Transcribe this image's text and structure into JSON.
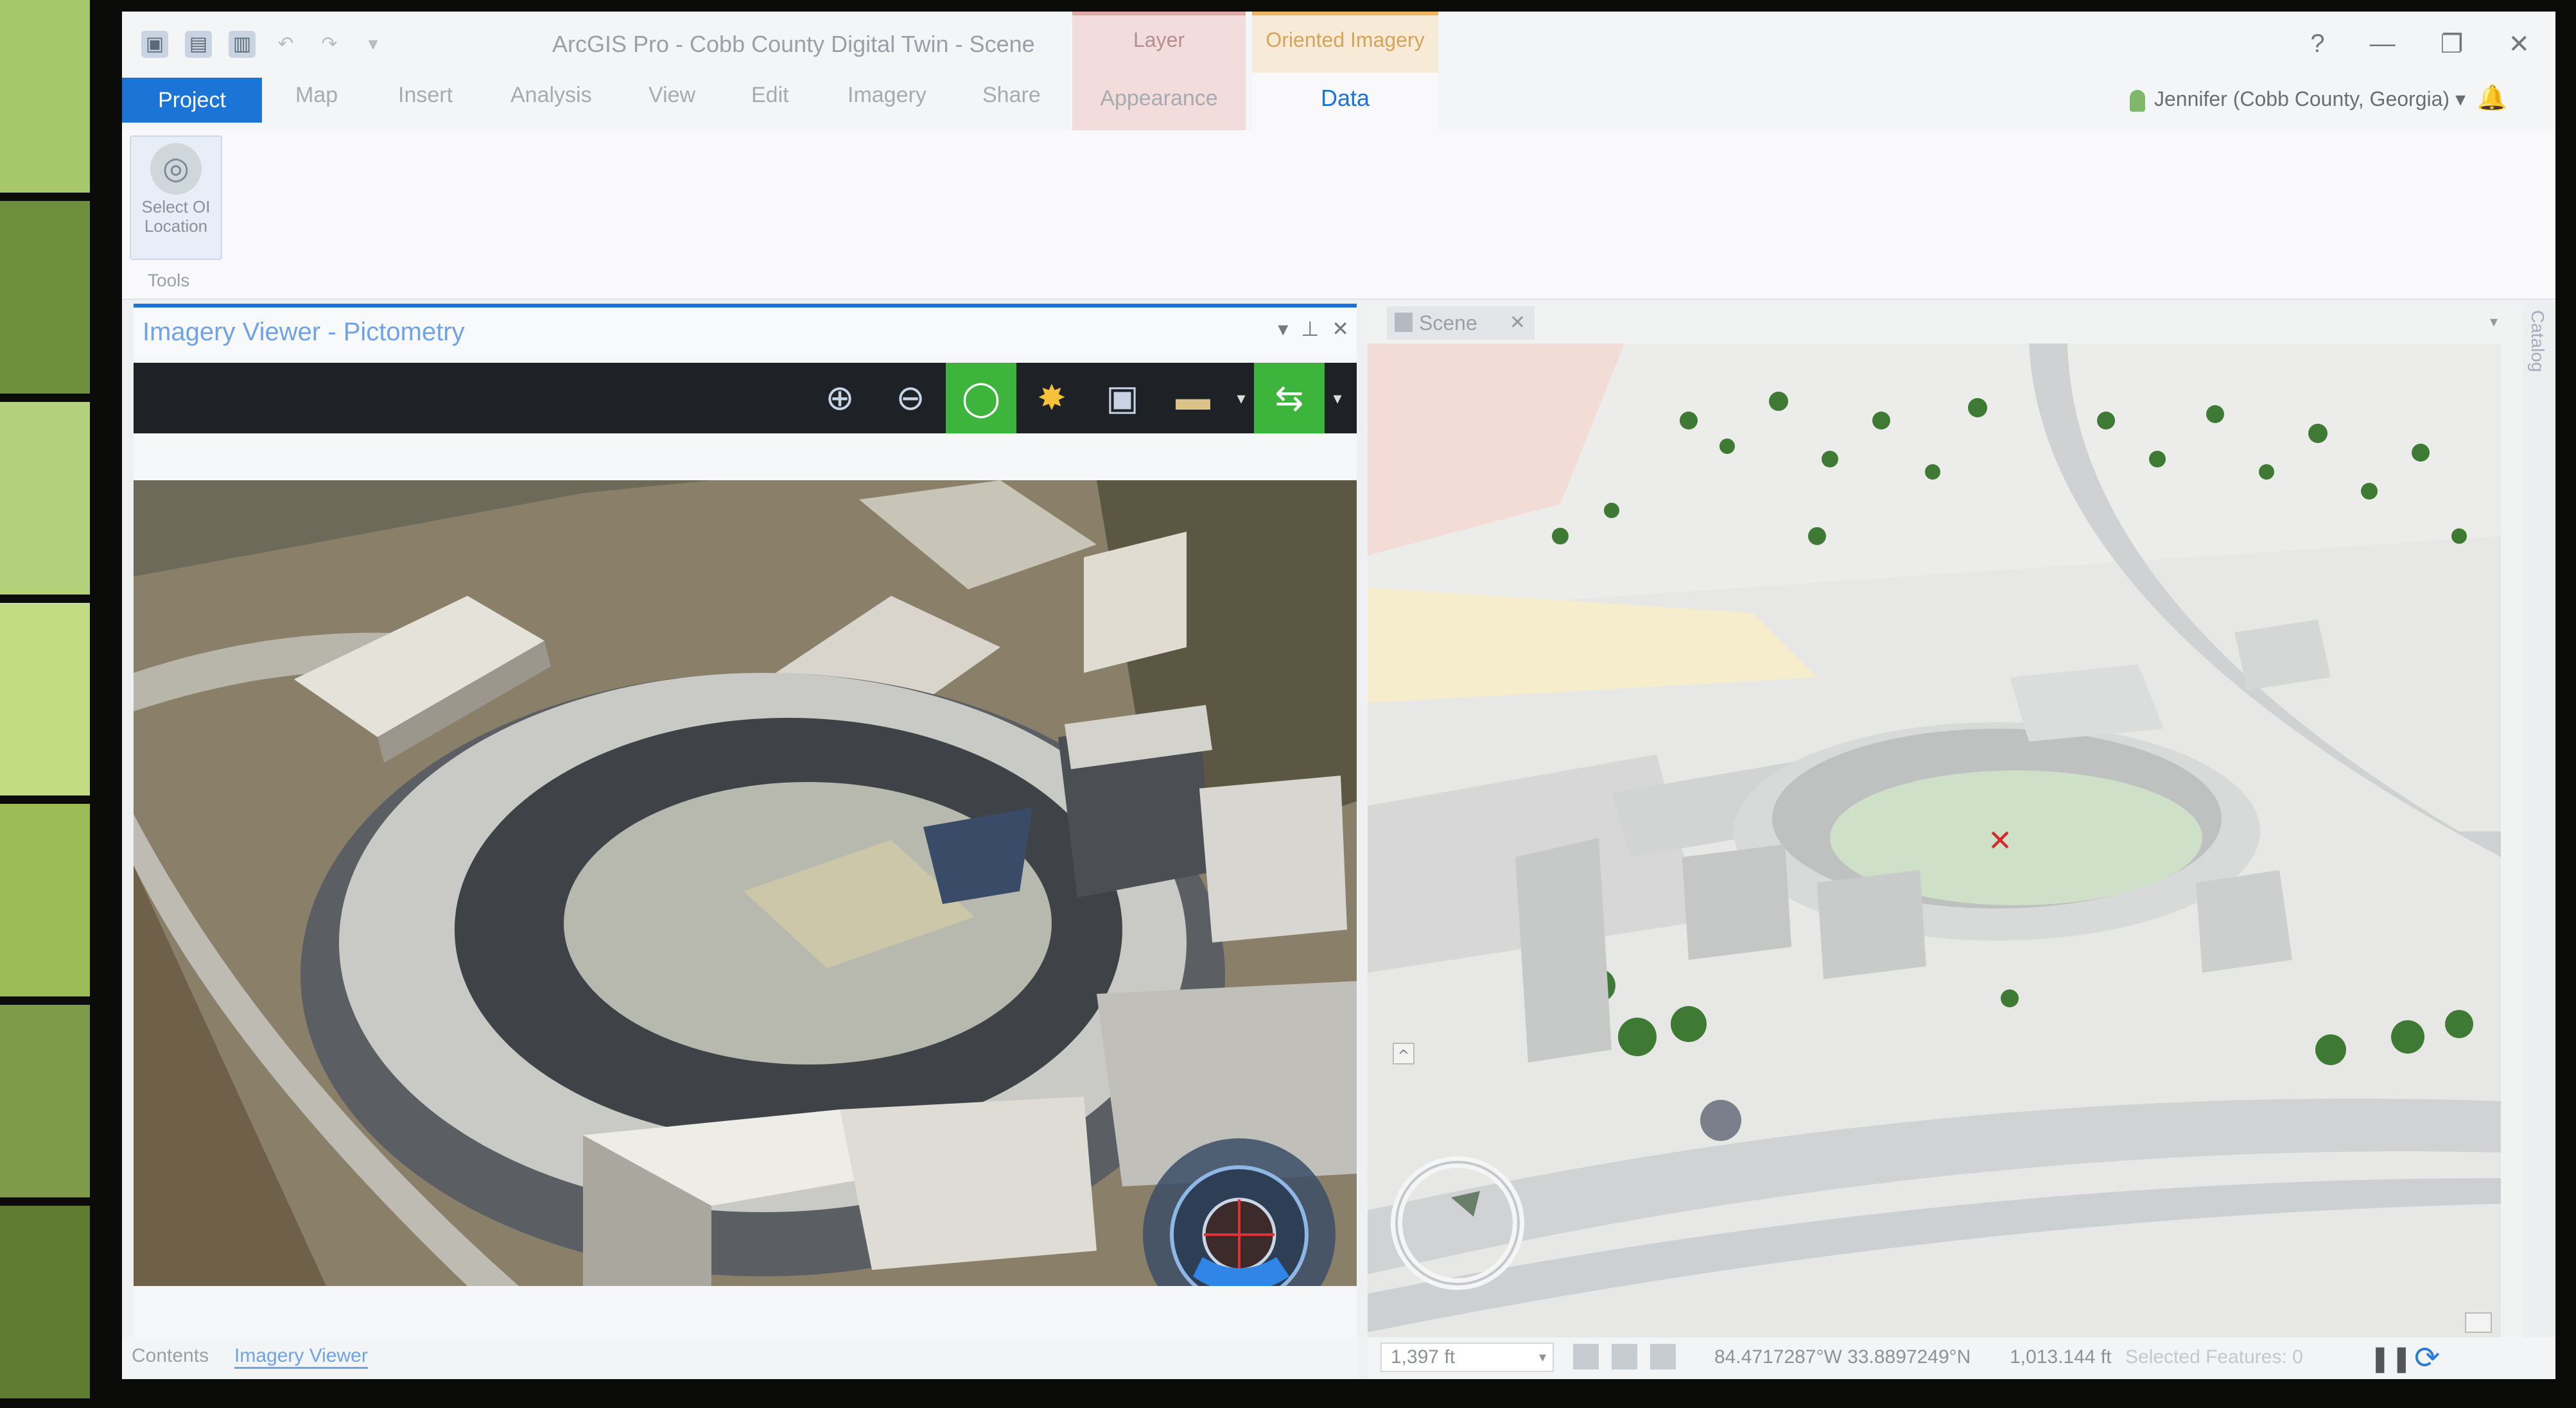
{
  "window": {
    "title": "ArcGIS Pro - Cobb County Digital Twin - Scene",
    "controls": [
      "?",
      "—",
      "❐",
      "✕"
    ]
  },
  "contextual_tabs": {
    "layer": "Layer",
    "oriented_imagery": "Oriented Imagery"
  },
  "ribbon_tabs": {
    "project": "Project",
    "map": "Map",
    "insert": "Insert",
    "analysis": "Analysis",
    "view": "View",
    "edit": "Edit",
    "imagery": "Imagery",
    "share": "Share",
    "appearance": "Appearance",
    "data": "Data"
  },
  "user": {
    "name": "Jennifer (Cobb County, Georgia)",
    "menu_glyph": "▾"
  },
  "ribbon": {
    "select_oi_line1": "Select OI",
    "select_oi_line2": "Location",
    "group_tools": "Tools"
  },
  "imagery_viewer": {
    "title": "Imagery Viewer - Pictometry",
    "pane_controls": [
      "▾",
      "⊥",
      "✕"
    ],
    "toolbar_icons": [
      "zoom-in-icon",
      "zoom-out-icon",
      "rotate-icon",
      "brightness-icon",
      "frame-icon",
      "measure-icon",
      "swap-icon"
    ],
    "toolbar_active_color": "#3db53d",
    "image": "oblique aerial photo of baseball stadium"
  },
  "scene": {
    "tab_label": "Scene",
    "map": "3D scene of stadium and surrounding buildings"
  },
  "catalog": {
    "label": "Catalog"
  },
  "bottom_tabs": {
    "contents": "Contents",
    "imagery_viewer": "Imagery Viewer"
  },
  "status_bar": {
    "scale": "1,397 ft",
    "coordinates": "84.4717287°W 33.8897249°N",
    "elevation": "1,013.144 ft",
    "selected_features": "Selected Features: 0"
  },
  "colors": {
    "accent": "#1b74d6",
    "project_tab_bg": "#1b74d6",
    "layer_ctx_bg": "#f2dcdc",
    "oi_ctx_bg": "#f7ead6"
  }
}
